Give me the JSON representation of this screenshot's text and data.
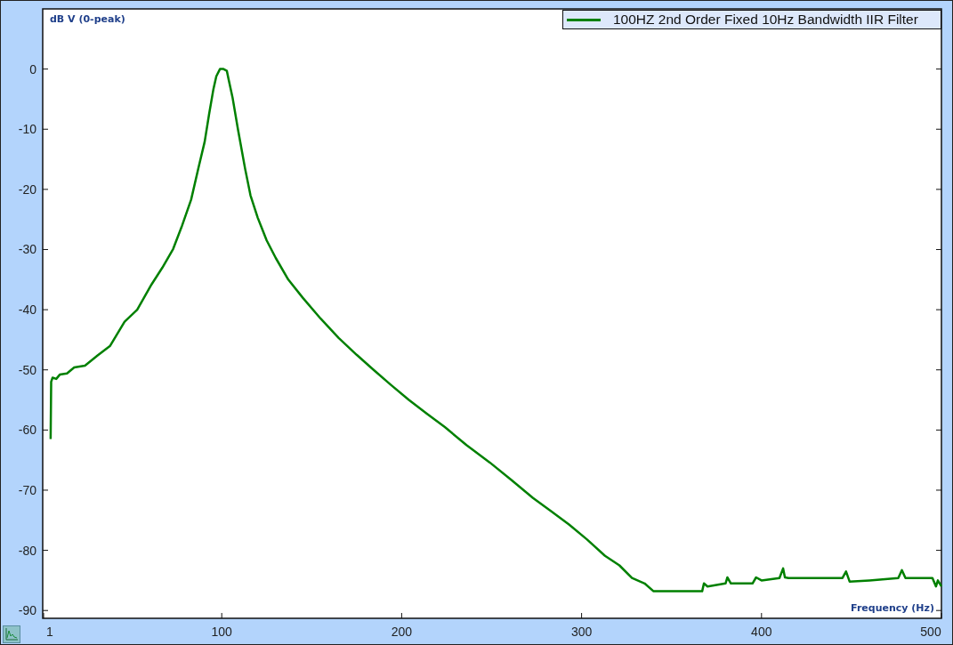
{
  "plot": {
    "chart_data": {
      "type": "line",
      "ylabel": "dB V (0-peak)",
      "xlabel": "Frequency (Hz)",
      "xlim": [
        0.5,
        500
      ],
      "ylim": [
        -91.3,
        10
      ],
      "xticks": [
        1,
        100,
        200,
        300,
        400,
        500
      ],
      "yticks": [
        0,
        -10,
        -20,
        -30,
        -40,
        -50,
        -60,
        -70,
        -80,
        -90
      ],
      "x": [
        4.9,
        5.2,
        6,
        8,
        10,
        14,
        18,
        24,
        31,
        38,
        46,
        53,
        61,
        67,
        73,
        78,
        83,
        87,
        90.5,
        93,
        95.4,
        97,
        99,
        101,
        102.8,
        104,
        106,
        109,
        113,
        116,
        120,
        125,
        130,
        137,
        145,
        155,
        165,
        175,
        184,
        194,
        204,
        214,
        224,
        236,
        249,
        261,
        273,
        283,
        293,
        303,
        313,
        321,
        328,
        335,
        340,
        367,
        368,
        370,
        380,
        381,
        383,
        395,
        397,
        400,
        410,
        412,
        413,
        415,
        445,
        447,
        449,
        460,
        476,
        478,
        480,
        495,
        497,
        498,
        500
      ],
      "series": [
        {
          "name": "100HZ 2nd Order Fixed 10Hz Bandwidth IIR Filter",
          "color": "#008000",
          "values": [
            -61.5,
            -52,
            -51.3,
            -51.5,
            -50.8,
            -50.6,
            -49.6,
            -49.3,
            -47.6,
            -46,
            -42,
            -40,
            -35.8,
            -33,
            -29.9,
            -26,
            -21.7,
            -16.5,
            -12.1,
            -7.5,
            -3.3,
            -1.2,
            0,
            0,
            -0.3,
            -2,
            -4.7,
            -10,
            -16.6,
            -21,
            -24.7,
            -28.5,
            -31.4,
            -35,
            -38,
            -41.5,
            -44.7,
            -47.5,
            -49.9,
            -52.5,
            -55,
            -57.3,
            -59.5,
            -62.5,
            -65.4,
            -68.3,
            -71.3,
            -73.5,
            -75.7,
            -78.2,
            -80.9,
            -82.5,
            -84.6,
            -85.5,
            -86.8,
            -86.8,
            -85.5,
            -86,
            -85.5,
            -84.5,
            -85.5,
            -85.5,
            -84.5,
            -85,
            -84.6,
            -83,
            -84.5,
            -84.6,
            -84.6,
            -83.5,
            -85.2,
            -85,
            -84.6,
            -83.3,
            -84.6,
            -84.6,
            -86,
            -85,
            -86
          ]
        }
      ]
    }
  }
}
